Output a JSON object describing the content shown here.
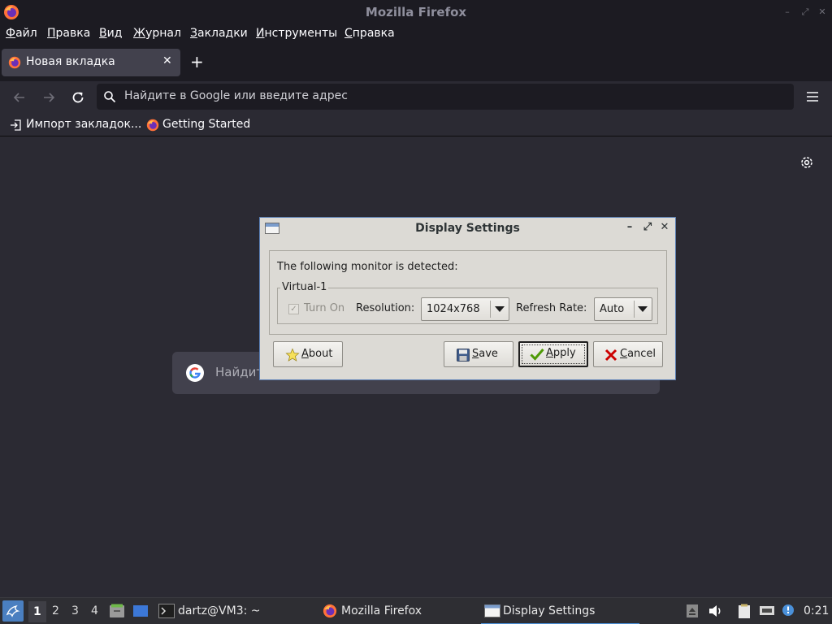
{
  "window": {
    "title": "Mozilla Firefox",
    "controls": [
      "–",
      "⤢",
      "✕"
    ]
  },
  "menu": {
    "items": [
      {
        "mnemonic": "Ф",
        "rest": "айл"
      },
      {
        "mnemonic": "П",
        "rest": "равка"
      },
      {
        "mnemonic": "В",
        "rest": "ид"
      },
      {
        "mnemonic": "Ж",
        "rest": "урнал"
      },
      {
        "mnemonic": "З",
        "rest": "акладки"
      },
      {
        "mnemonic": "И",
        "rest": "нструменты"
      },
      {
        "mnemonic": "С",
        "rest": "правка"
      }
    ]
  },
  "tabs": {
    "active_label": "Новая вкладка",
    "close_glyph": "✕",
    "new_tab_glyph": "+"
  },
  "navbar": {
    "url_placeholder": "Найдите в Google или введите адрес"
  },
  "bookmarks": {
    "import_label": "Импорт закладок...",
    "getting_started_label": "Getting Started"
  },
  "newtab_page": {
    "search_placeholder": "Найдите"
  },
  "dialog": {
    "title": "Display Settings",
    "controls": [
      "–",
      "⤢",
      "✕"
    ],
    "detected_text": "The following monitor is detected:",
    "monitor_name": "Virtual-1",
    "turn_on_label": "Turn On",
    "turn_on_checked": true,
    "resolution_label": "Resolution:",
    "resolution_value": "1024x768",
    "refresh_label": "Refresh Rate:",
    "refresh_value": "Auto",
    "buttons": {
      "about": {
        "mnemonic": "A",
        "rest": "bout"
      },
      "save": {
        "mnemonic": "S",
        "rest": "ave"
      },
      "apply": {
        "mnemonic": "A",
        "rest": "pply"
      },
      "cancel": {
        "mnemonic": "C",
        "rest": "ancel"
      }
    }
  },
  "taskbar": {
    "workspaces": [
      "1",
      "2",
      "3",
      "4"
    ],
    "active_workspace": "1",
    "tasks": [
      {
        "label": "dartz@VM3: ~"
      },
      {
        "label": "Mozilla Firefox"
      },
      {
        "label": "Display Settings"
      }
    ],
    "clock": "0:21"
  },
  "colors": {
    "firefox_dark": "#1c1b22",
    "firefox_content": "#2b2a33",
    "dialog_bg": "#dcdad5",
    "dialog_border": "#5a7fb5",
    "taskbar_bg": "#2e2e33"
  }
}
